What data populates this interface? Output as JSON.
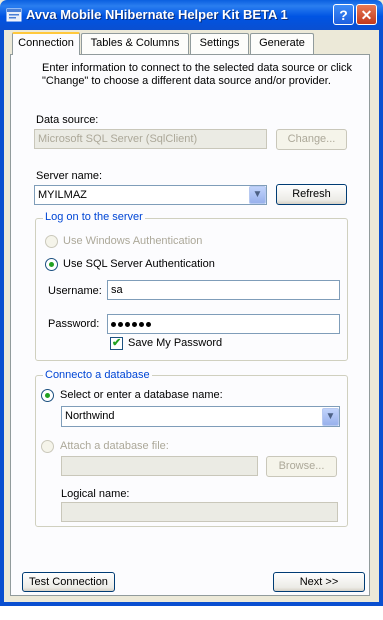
{
  "window": {
    "title": "Avva Mobile NHibernate Helper Kit BETA 1",
    "help_glyph": "?",
    "close_glyph": "✕"
  },
  "tabs": [
    {
      "label": "Connection",
      "active": true
    },
    {
      "label": "Tables & Columns",
      "active": false
    },
    {
      "label": "Settings",
      "active": false
    },
    {
      "label": "Generate",
      "active": false
    }
  ],
  "intro_text": "Enter information to connect to the selected data source or click \"Change\" to choose a different data source and/or provider.",
  "data_source": {
    "label": "Data source:",
    "value": "Microsoft SQL Server (SqlClient)",
    "change_button": "Change..."
  },
  "server": {
    "label": "Server name:",
    "value": "MYILMAZ",
    "refresh_button": "Refresh"
  },
  "logon": {
    "group_title": "Log on to the server",
    "windows_auth_label": "Use Windows Authentication",
    "sql_auth_label": "Use SQL Server Authentication",
    "selected_auth": "sql",
    "username_label": "Username:",
    "username_value": "sa",
    "password_label": "Password:",
    "password_length": 6,
    "save_password_label": "Save My Password",
    "save_password_checked": true
  },
  "database": {
    "group_title": "Connecto a database",
    "select_label": "Select or enter a database name:",
    "selected_database": "Northwind",
    "attach_label": "Attach a database file:",
    "browse_button": "Browse...",
    "logical_name_label": "Logical name:"
  },
  "footer": {
    "test_connection_button": "Test Connection",
    "next_button": "Next >>"
  },
  "colors": {
    "title_bar": "#0054e3",
    "group_title": "#0046d5",
    "window_bg": "#ece9d8",
    "tab_highlight": "#ffc83c"
  }
}
